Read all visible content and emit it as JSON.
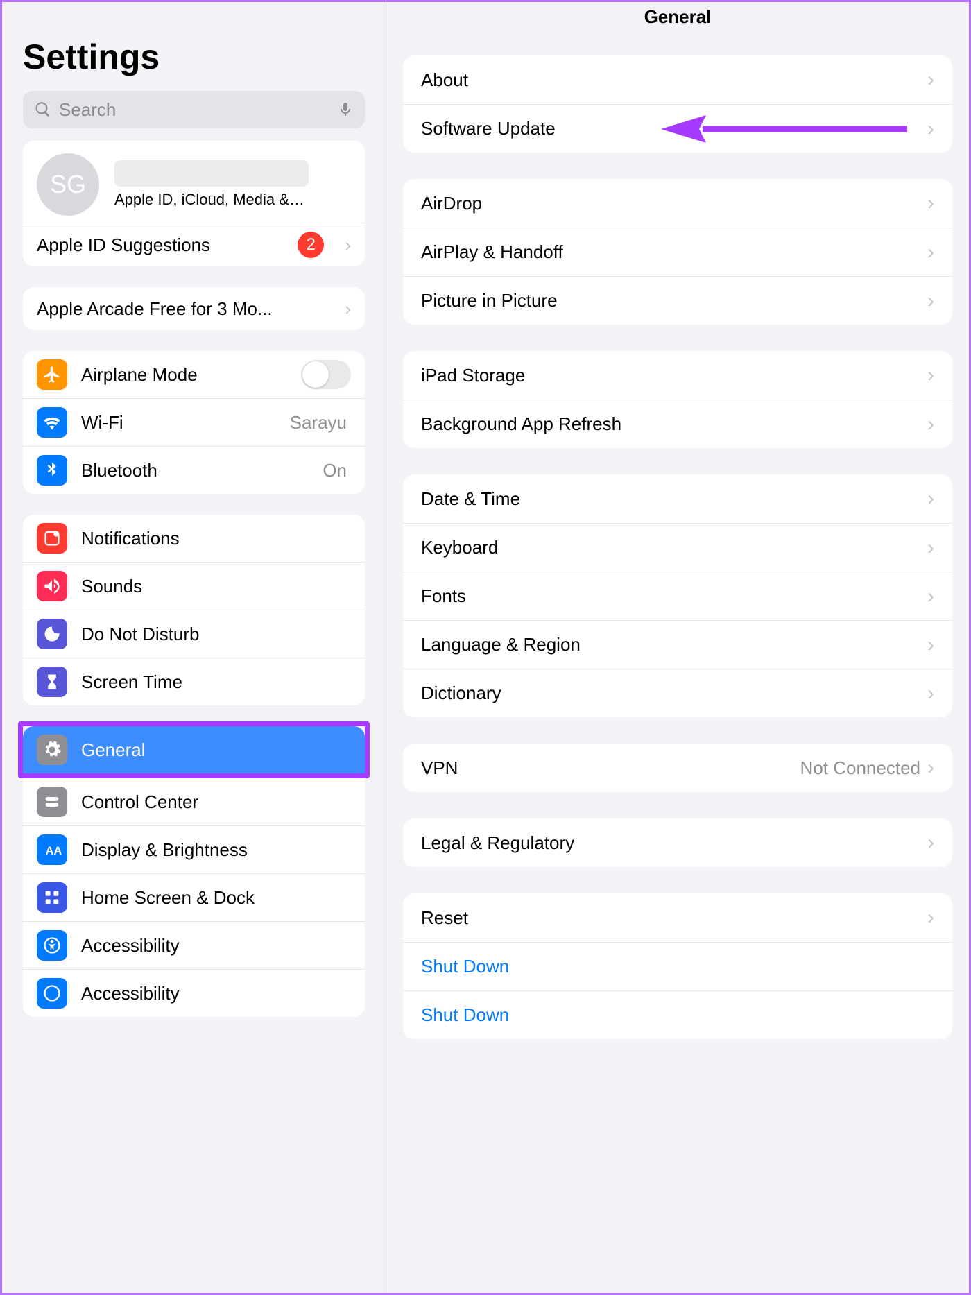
{
  "sidebar": {
    "title": "Settings",
    "search_placeholder": "Search",
    "profile": {
      "initials": "SG",
      "subtitle": "Apple ID, iCloud, Media &…"
    },
    "apple_id_suggestions": {
      "label": "Apple ID Suggestions",
      "badge": "2"
    },
    "promo": {
      "label": "Apple Arcade Free for 3 Mo..."
    },
    "network": {
      "airplane": "Airplane Mode",
      "wifi": "Wi-Fi",
      "wifi_value": "Sarayu",
      "bluetooth": "Bluetooth",
      "bluetooth_value": "On"
    },
    "notif_group": {
      "notifications": "Notifications",
      "sounds": "Sounds",
      "dnd": "Do Not Disturb",
      "screentime": "Screen Time"
    },
    "system_group": {
      "general": "General",
      "control_center": "Control Center",
      "display": "Display & Brightness",
      "homescreen": "Home Screen & Dock",
      "accessibility": "Accessibility",
      "accessibility2": "Accessibility"
    }
  },
  "main": {
    "title": "General",
    "group1": {
      "about": "About",
      "software_update": "Software Update"
    },
    "group2": {
      "airdrop": "AirDrop",
      "airplay": "AirPlay & Handoff",
      "pip": "Picture in Picture"
    },
    "group3": {
      "storage": "iPad Storage",
      "bgrefresh": "Background App Refresh"
    },
    "group4": {
      "datetime": "Date & Time",
      "keyboard": "Keyboard",
      "fonts": "Fonts",
      "language": "Language & Region",
      "dictionary": "Dictionary"
    },
    "group5": {
      "vpn": "VPN",
      "vpn_value": "Not Connected"
    },
    "group6": {
      "legal": "Legal & Regulatory"
    },
    "group7": {
      "reset": "Reset",
      "shutdown": "Shut Down",
      "shutdown2": "Shut Down"
    }
  }
}
